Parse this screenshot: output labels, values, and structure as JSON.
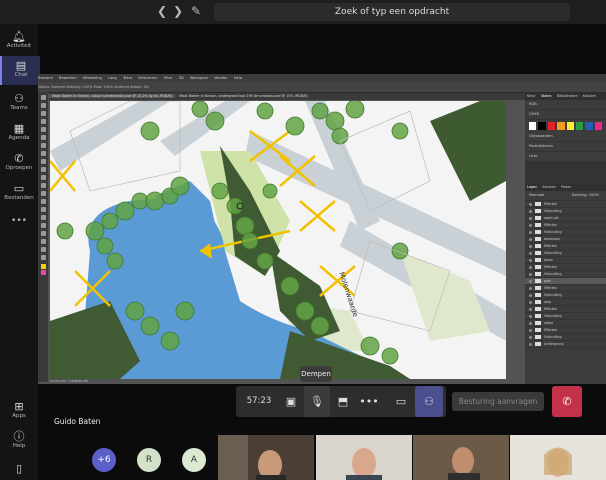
{
  "top_bar": {
    "search_placeholder": "Zoek of typ een opdracht",
    "back_icon": "chevron-left-icon",
    "forward_icon": "chevron-right-icon",
    "compose_icon": "compose-icon"
  },
  "rail": {
    "items": [
      {
        "label": "Activiteit",
        "icon": "bell-icon"
      },
      {
        "label": "Chat",
        "icon": "chat-icon",
        "active": true
      },
      {
        "label": "Teams",
        "icon": "teams-icon"
      },
      {
        "label": "Agenda",
        "icon": "calendar-icon"
      },
      {
        "label": "Oproepen",
        "icon": "phone-icon"
      },
      {
        "label": "Bestanden",
        "icon": "file-icon"
      }
    ],
    "more": "•••",
    "bottom": [
      {
        "label": "Apps",
        "icon": "apps-icon"
      },
      {
        "label": "Help",
        "icon": "help-icon"
      }
    ]
  },
  "photoshop": {
    "menu": [
      "Bestand",
      "Bewerken",
      "Afbeelding",
      "Laag",
      "Tekst",
      "Selecteren",
      "Filter",
      "3D",
      "Weergave",
      "Venster",
      "Help"
    ],
    "options": "Modus: Normaal    Dekking: 100%    Flow: 100%    Vloeiend maken: 0%",
    "doc_tab": "Maat Batlen in Knivan, colour schetsmaxle.psd @ 15,2% (grün, RGB/8)",
    "doc_tab_2": "Maat Batlen in Knivan, ondergrond kpo 195 de ontwarp.psd @ 15% (RGB/8)",
    "status": "15,2%     Doc: 1,99M/35,3M",
    "map_label": "Molenwaarde",
    "panel_tabs": [
      "Kleur",
      "Stalen",
      "Bibliotheken",
      "Kanalen"
    ],
    "swatch_colors": [
      "#ffffff",
      "#000000",
      "#e8202a",
      "#f39c1d",
      "#f9ed32",
      "#2a9d3e",
      "#2361b0",
      "#ec2a8a"
    ],
    "swatch_folders": [
      "RGB",
      "CMYK",
      "Grijswaarden",
      "Pastelkleuren",
      "Licht"
    ],
    "layer_tabs": [
      "Lagen",
      "Kanalen",
      "Paden"
    ],
    "layer_blend": "Normaal",
    "layer_opacity": "Dekking: 100%",
    "layers": [
      "Effecten",
      "Vlakvulling",
      "zwart-wit",
      "Effecten",
      "Vlakvulling",
      "boomlaan",
      "Effecten",
      "Vlakvulling",
      "boom",
      "Effecten",
      "Vlakvulling",
      "gras",
      "Effecten",
      "Vlakvulling",
      "weg",
      "Effecten",
      "Vlakvulling",
      "water",
      "Effecten",
      "Vlakvulling",
      "Achtergrond"
    ]
  },
  "call_controls": {
    "timer": "57:23",
    "tooltip": "Dempen",
    "request_control": "Besturing aanvragen",
    "icons": [
      "camera-icon",
      "microphone-icon",
      "share-screen-icon",
      "more-icon",
      "chat-bubble-icon",
      "participants-icon",
      "hangup-icon"
    ]
  },
  "participants": {
    "presenter_name": "Guido Baten",
    "overflow": "+6",
    "avatars": [
      {
        "initial": "R",
        "color": "#d4e1c9"
      },
      {
        "initial": "A",
        "color": "#dce9d3"
      }
    ],
    "overflow_color": "#5b5fc7"
  }
}
